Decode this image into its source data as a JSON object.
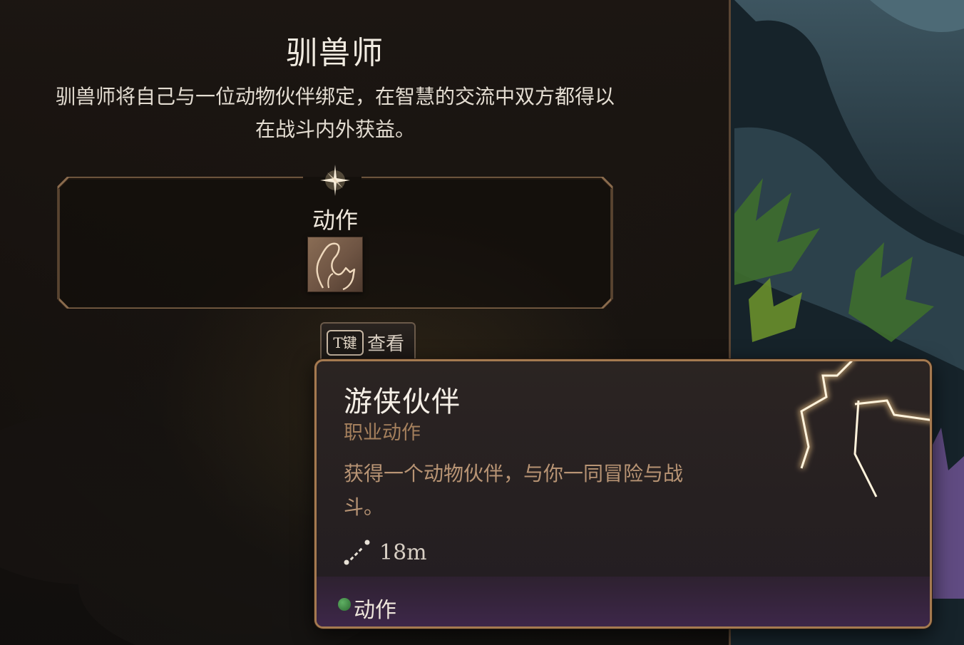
{
  "subclass": {
    "title": "驯兽师",
    "description_lines": [
      "驯兽师将自己与一位动物伙伴绑定，在智慧的交流中双方都得以",
      "在战斗内外获益。"
    ]
  },
  "actions_section": {
    "label": "动作",
    "icon": "animal-companion-icon"
  },
  "view_button": {
    "key": "T键",
    "label": "查看"
  },
  "tooltip": {
    "title": "游侠伙伴",
    "subtitle": "职业动作",
    "description_lines": [
      "获得一个动物伙伴，与你一同冒险与战",
      "斗。"
    ],
    "range": "18m",
    "range_icon": "range-icon",
    "footer": {
      "label": "动作",
      "dot_color": "#3f9a47"
    }
  },
  "colors": {
    "accent_gold": "#a57a50",
    "subtitle_tan": "#a5805d",
    "desc_tan": "#b89474",
    "footer_purple": "#3d2749"
  }
}
